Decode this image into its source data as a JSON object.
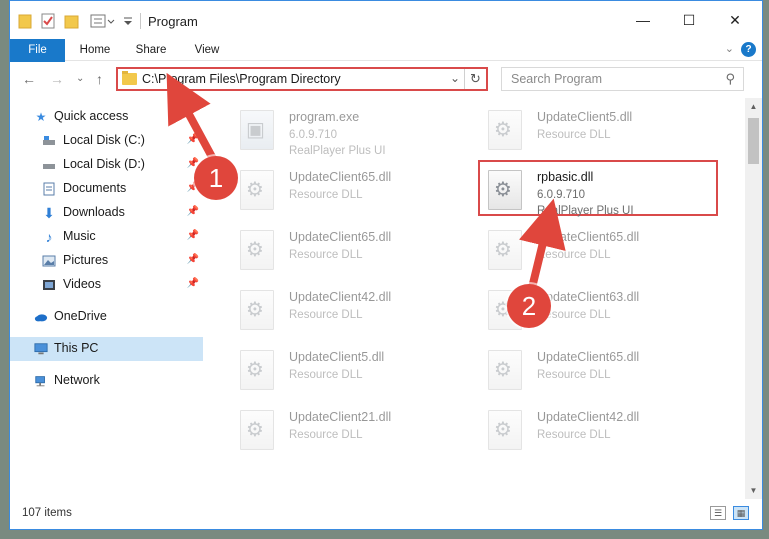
{
  "window": {
    "title": "Program",
    "controls": {
      "minimize": "—",
      "maximize": "☐",
      "close": "✕"
    }
  },
  "ribbon": {
    "tabs": [
      "File",
      "Home",
      "Share",
      "View"
    ],
    "help": "?"
  },
  "address_bar": {
    "path": "C:\\Program Files\\Program Directory"
  },
  "search": {
    "placeholder": "Search Program"
  },
  "sidebar": {
    "items": [
      {
        "label": "Quick access",
        "icon": "star-icon"
      },
      {
        "label": "Local Disk (C:)",
        "icon": "drive-icon"
      },
      {
        "label": "Local Disk (D:)",
        "icon": "drive-icon"
      },
      {
        "label": "Documents",
        "icon": "documents-icon"
      },
      {
        "label": "Downloads",
        "icon": "download-icon"
      },
      {
        "label": "Music",
        "icon": "music-icon"
      },
      {
        "label": "Pictures",
        "icon": "pictures-icon"
      },
      {
        "label": "Videos",
        "icon": "videos-icon"
      },
      {
        "label": "OneDrive",
        "icon": "cloud-icon"
      },
      {
        "label": "This PC",
        "icon": "computer-icon"
      },
      {
        "label": "Network",
        "icon": "network-icon"
      }
    ],
    "selected": "This PC"
  },
  "files": [
    {
      "name": "program.exe",
      "line1": "6.0.9.710",
      "line2": "RealPlayer Plus UI"
    },
    {
      "name": "UpdateClient5.dll",
      "line1": "Resource DLL",
      "line2": ""
    },
    {
      "name": "UpdateClient65.dll",
      "line1": "Resource DLL",
      "line2": ""
    },
    {
      "name": "rpbasic.dll",
      "line1": "6.0.9.710",
      "line2": "RealPlayer Plus UI"
    },
    {
      "name": "UpdateClient65.dll",
      "line1": "Resource DLL",
      "line2": ""
    },
    {
      "name": "UpdateClient65.dll",
      "line1": "Resource DLL",
      "line2": ""
    },
    {
      "name": "UpdateClient42.dll",
      "line1": "Resource DLL",
      "line2": ""
    },
    {
      "name": "UpdateClient63.dll",
      "line1": "Resource DLL",
      "line2": ""
    },
    {
      "name": "UpdateClient5.dll",
      "line1": "Resource DLL",
      "line2": ""
    },
    {
      "name": "UpdateClient65.dll",
      "line1": "Resource DLL",
      "line2": ""
    },
    {
      "name": "UpdateClient21.dll",
      "line1": "Resource DLL",
      "line2": ""
    },
    {
      "name": "UpdateClient42.dll",
      "line1": "Resource DLL",
      "line2": ""
    }
  ],
  "status": {
    "count": "107 items"
  },
  "annotations": {
    "step1": "1",
    "step2": "2",
    "color": "#e0463c"
  }
}
